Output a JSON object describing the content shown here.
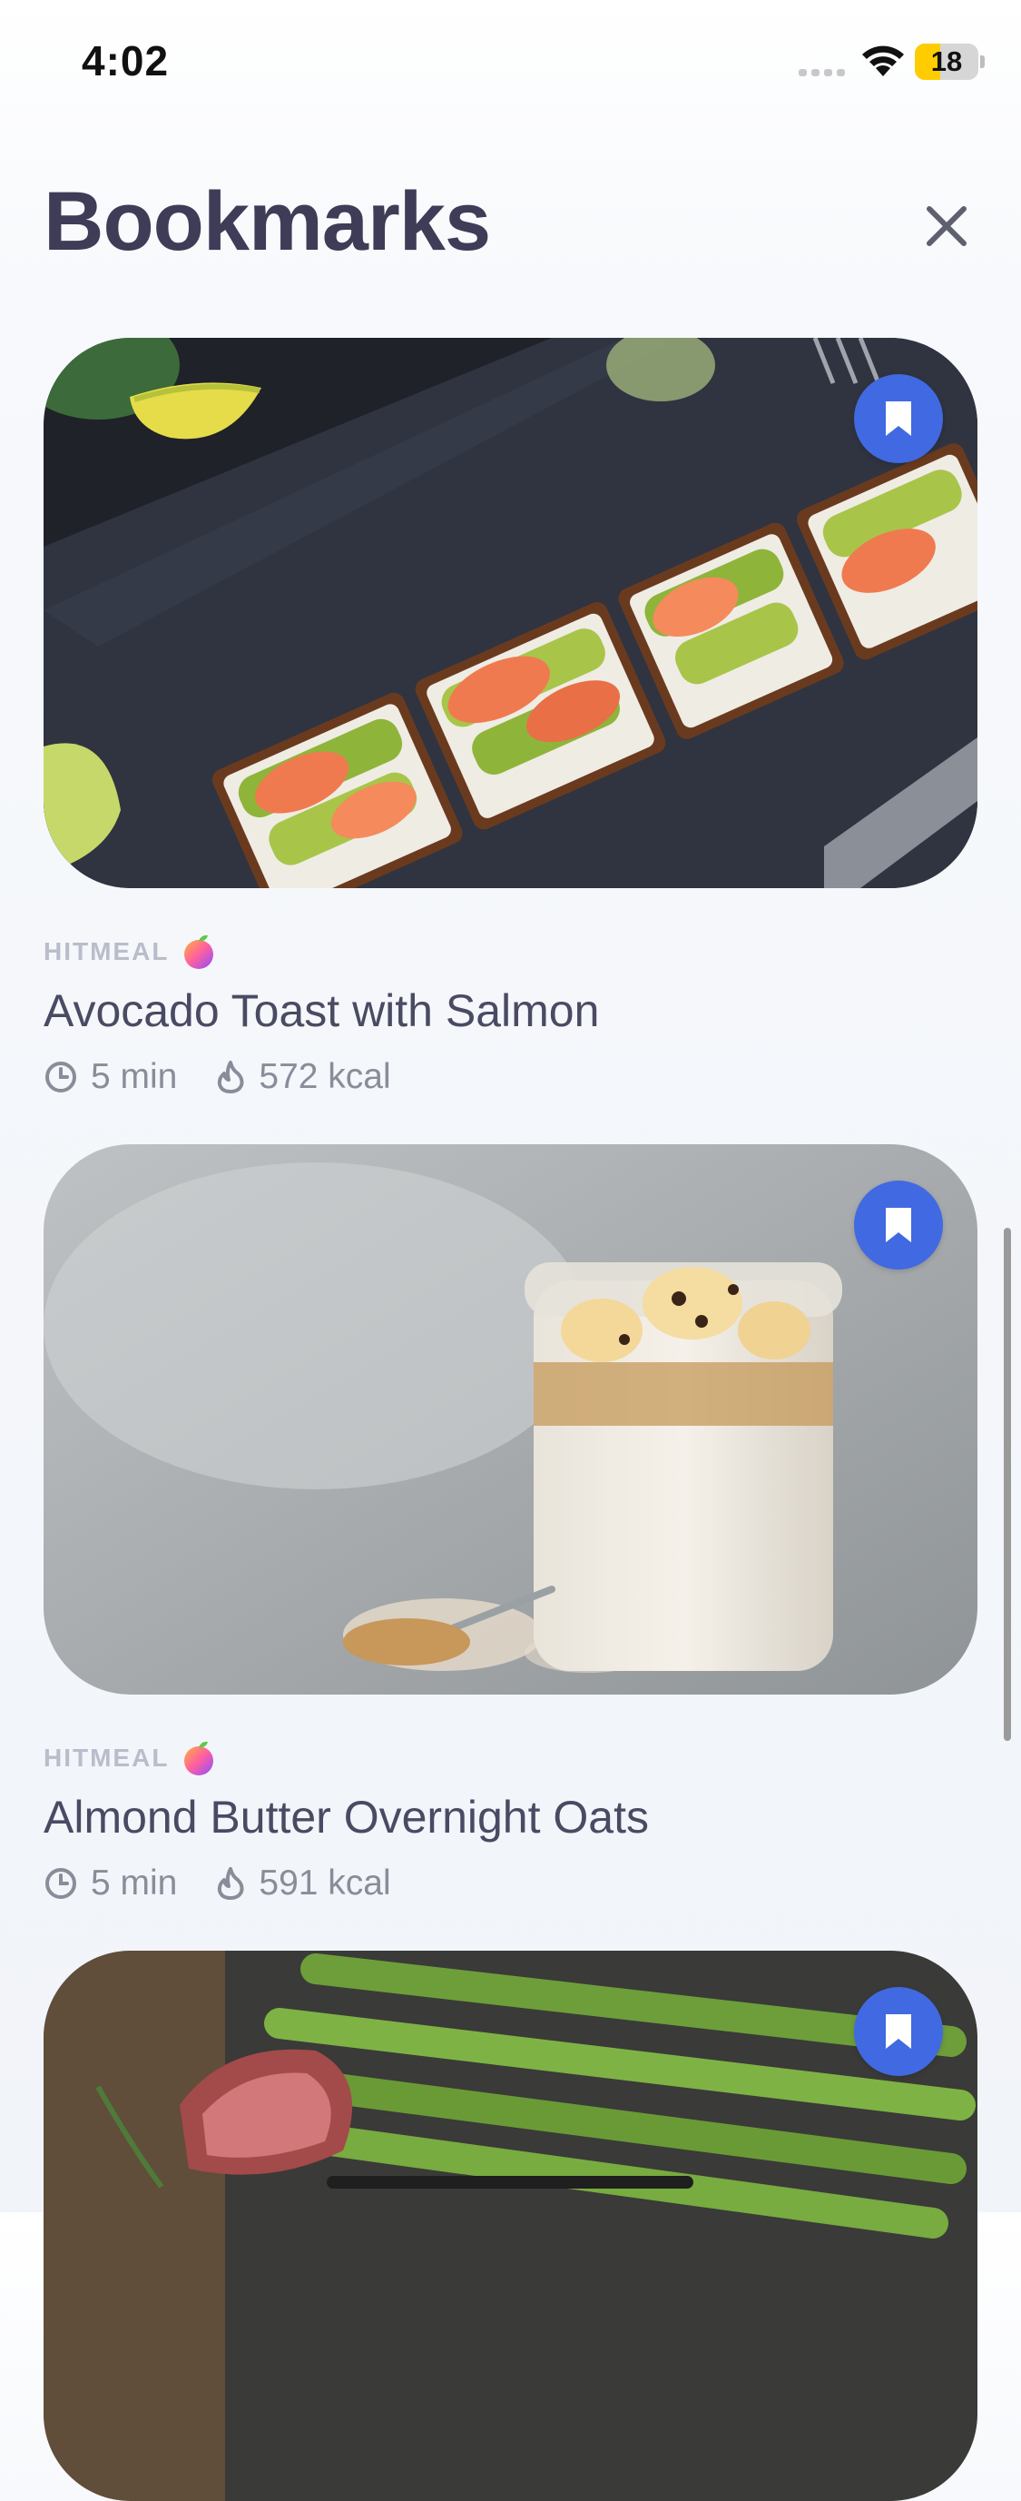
{
  "status_bar": {
    "time": "4:02",
    "battery_level": "18",
    "battery_fraction": 0.18,
    "icons": [
      "signal-icon",
      "wifi-icon",
      "battery-icon"
    ]
  },
  "header": {
    "title": "Bookmarks",
    "close_icon": "close-icon"
  },
  "colors": {
    "accent": "#4169e1",
    "title": "#3e3c57",
    "source_label": "#b9bdcb",
    "meta": "#8a8c99"
  },
  "recipes": [
    {
      "source": "HITMEAL",
      "title": "Avocado Toast with Salmon",
      "time": "5 min",
      "kcal": "572 kcal",
      "bookmarked": true
    },
    {
      "source": "HITMEAL",
      "title": "Almond Butter Overnight Oats",
      "time": "5 min",
      "kcal": "591 kcal",
      "bookmarked": true
    },
    {
      "source": "",
      "title": "",
      "time": "",
      "kcal": "",
      "bookmarked": true
    }
  ]
}
